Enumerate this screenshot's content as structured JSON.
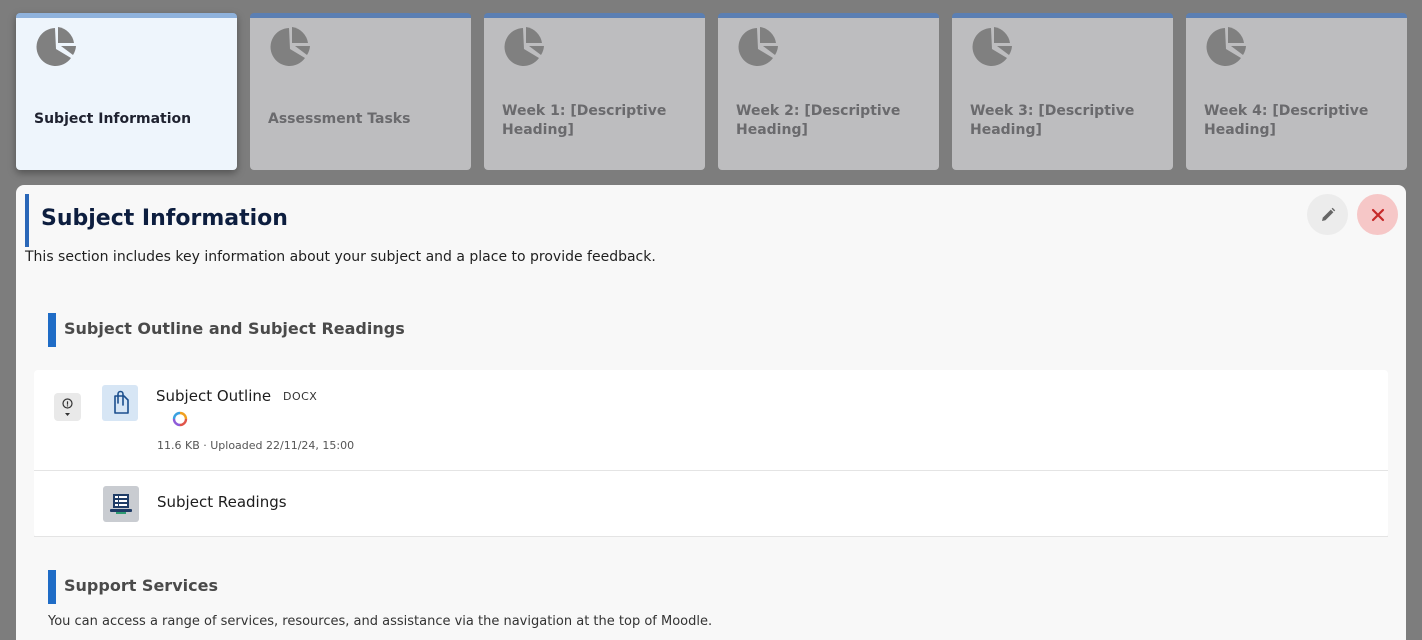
{
  "tiles": [
    {
      "label": "Subject Information",
      "active": true
    },
    {
      "label": "Assessment Tasks",
      "active": false
    },
    {
      "label": "Week 1: [Descriptive Heading]",
      "active": false
    },
    {
      "label": "Week 2: [Descriptive Heading]",
      "active": false
    },
    {
      "label": "Week 3: [Descriptive Heading]",
      "active": false
    },
    {
      "label": "Week 4: [Descriptive Heading]",
      "active": false
    }
  ],
  "tile_icon": "pie-chart-icon",
  "panel": {
    "title": "Subject Information",
    "description": "This section includes key information about your subject and a place to provide feedback.",
    "edit_icon": "pencil-icon",
    "close_icon": "close-icon"
  },
  "sections": [
    {
      "title": "Subject Outline and Subject Readings"
    },
    {
      "title": "Support Services",
      "description": "You can access a range of services, resources, and assistance via the navigation at the top of Moodle."
    }
  ],
  "items": {
    "outline": {
      "name": "Subject Outline",
      "type": "DOCX",
      "meta": "11.6 KB · Uploaded 22/11/24, 15:00",
      "icon": "document-clip-icon",
      "info_icon": "info-dropdown-icon",
      "sync_icon": "sync-icon"
    },
    "readings": {
      "name": "Subject Readings",
      "icon": "reading-list-icon"
    }
  },
  "colors": {
    "accent": "#1f6cc6",
    "title": "#0d1e3f",
    "tile_top": "#5b7fb3",
    "close_bg": "#f6c7c7",
    "close_x": "#c62828"
  }
}
